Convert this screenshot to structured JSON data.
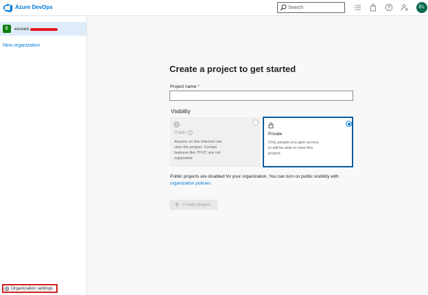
{
  "app": {
    "brand": "Azure DevOps",
    "search_placeholder": "Search",
    "avatar_initials": "EL"
  },
  "sidebar": {
    "org_badge": "E",
    "org_name": "exceed",
    "new_org_label": "New organization",
    "org_settings_label": "Organization settings"
  },
  "main": {
    "title": "Create a project to get started",
    "project_name_label": "Project name",
    "project_name_required": "*",
    "project_name_value": "",
    "visibility_label": "Visibility",
    "public": {
      "name": "Public",
      "description": "Anyone on the internet can view the project. Certain features like TFVC are not supported.",
      "selected": false,
      "disabled": true
    },
    "private": {
      "name": "Private",
      "description": "Only people you give access to will be able to view this project.",
      "selected": true
    },
    "notice_text": "Public projects are disabled for your organization. You can turn on public visibility with",
    "notice_link": "organization policies",
    "notice_end": ".",
    "create_button": "Create project"
  },
  "colors": {
    "accent": "#0078d4",
    "avatar_bg": "#0b6a4f",
    "org_badge_bg": "#107c10",
    "highlight_border": "#d01c1c",
    "redaction": "#e6141e"
  },
  "icons": {
    "logo": "azure-devops-logo",
    "search": "search-icon",
    "toolbar": [
      "list-icon",
      "shopping-bag-icon",
      "help-icon",
      "user-settings-icon"
    ],
    "public": "globe-icon",
    "private": "lock-icon",
    "info": "info-icon",
    "settings": "gear-icon",
    "create": "plus-icon"
  }
}
